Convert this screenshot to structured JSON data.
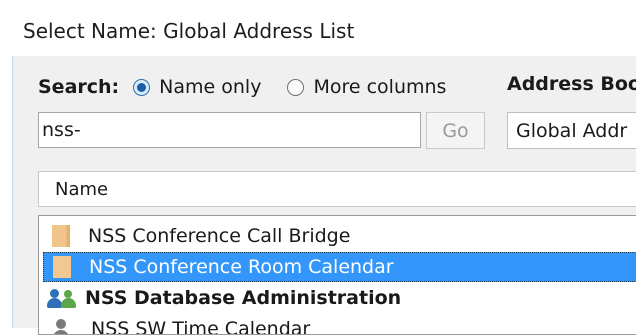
{
  "window": {
    "title": "Select Name: Global Address List"
  },
  "search": {
    "label": "Search:",
    "option_name_only": "Name only",
    "option_more_columns": "More columns",
    "selected_option": "Name only",
    "query": "nss-",
    "go_label": "Go"
  },
  "address_book": {
    "label": "Address Boo",
    "value": "Global Addr"
  },
  "list": {
    "column_header": "Name",
    "items": [
      {
        "name": "NSS Conference Call Bridge",
        "icon": "room-icon",
        "bold": false,
        "selected": false
      },
      {
        "name": "NSS Conference Room Calendar",
        "icon": "room-icon",
        "bold": false,
        "selected": true
      },
      {
        "name": "NSS Database Administration",
        "icon": "group-icon",
        "bold": true,
        "selected": false
      },
      {
        "name": "NSS SW Time Calendar",
        "icon": "user-icon",
        "bold": false,
        "selected": false
      }
    ]
  },
  "colors": {
    "selection": "#3296fa",
    "room_icon": "#f0c48a",
    "group_icon_blue": "#2e6fb8",
    "group_icon_green": "#5aa64a"
  }
}
